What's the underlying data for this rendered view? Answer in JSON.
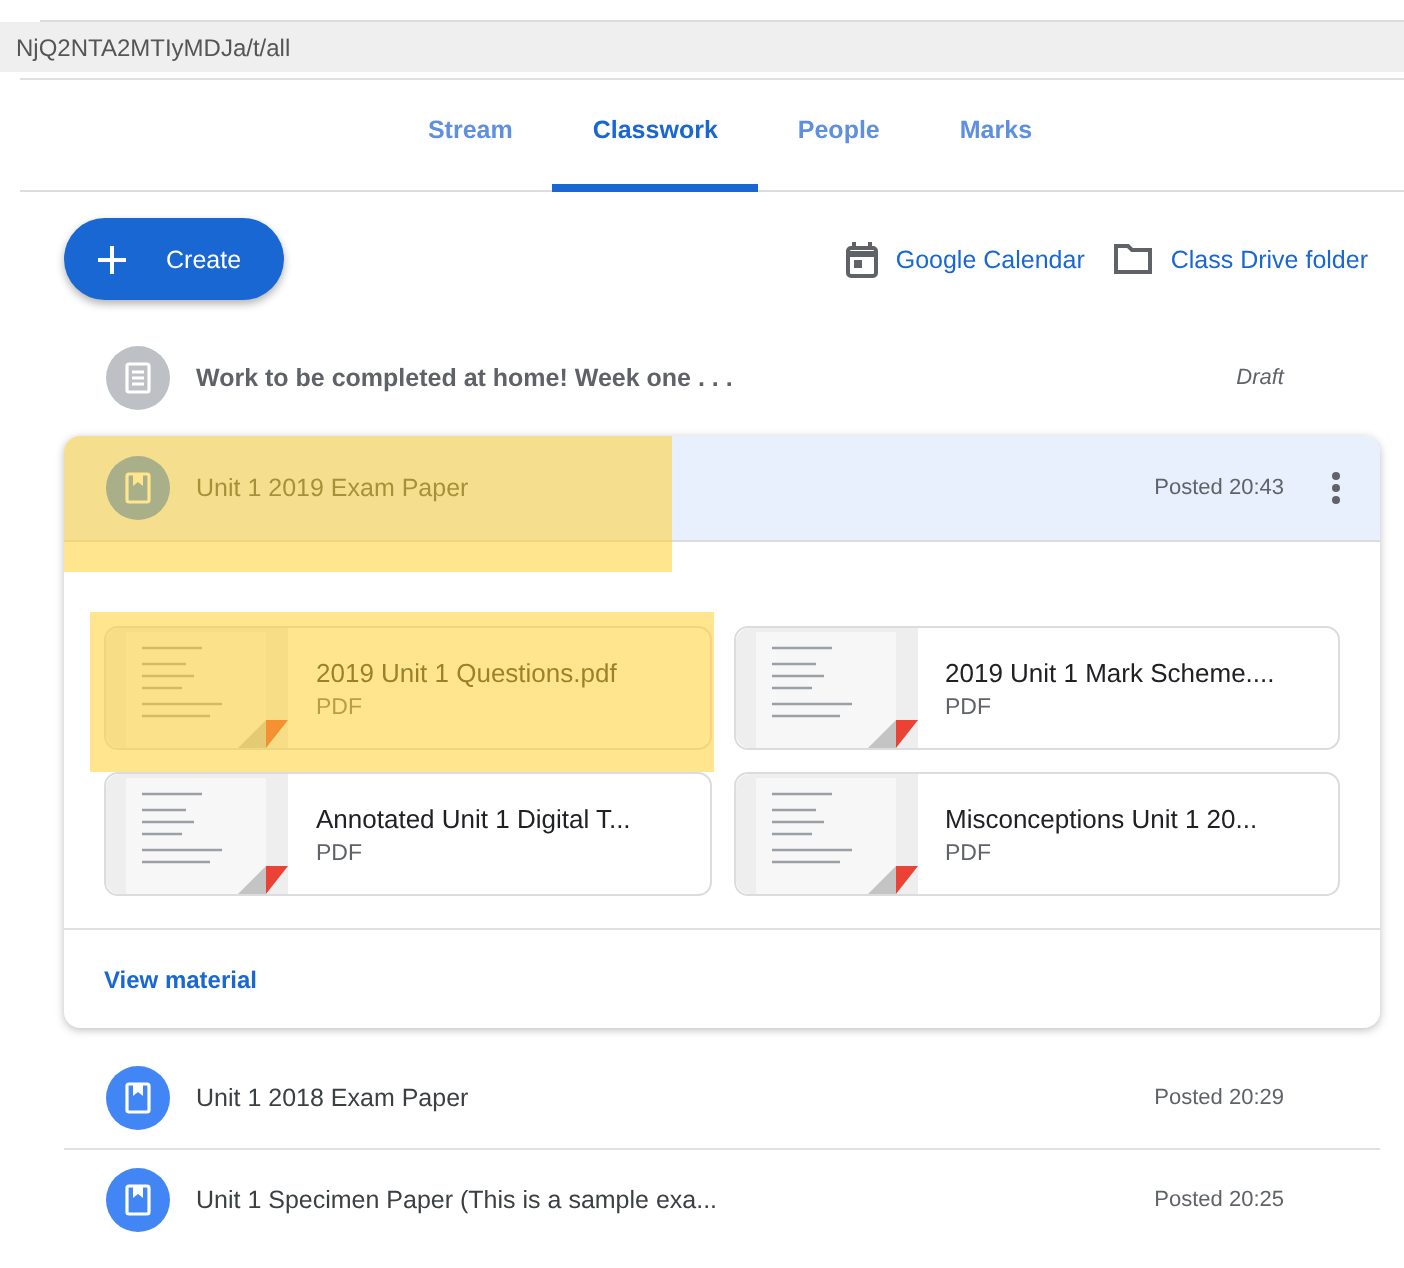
{
  "address_bar": {
    "url": "NjQ2NTA2MTIyMDJa/t/all"
  },
  "tabs": [
    {
      "label": "Stream",
      "selected": false
    },
    {
      "label": "Classwork",
      "selected": true
    },
    {
      "label": "People",
      "selected": false
    },
    {
      "label": "Marks",
      "selected": false
    }
  ],
  "create_button": {
    "label": "Create"
  },
  "links": [
    {
      "kind": "calendar",
      "label": "Google Calendar"
    },
    {
      "kind": "folder",
      "label": "Class Drive folder"
    }
  ],
  "items": [
    {
      "kind": "assignment",
      "title": "Work to be completed at home! Week one . . .",
      "status": "Draft",
      "draft": true,
      "expanded": false,
      "highlighted": false
    },
    {
      "kind": "material",
      "title": "Unit 1 2019 Exam Paper",
      "status": "Posted 20:43",
      "draft": false,
      "expanded": true,
      "highlighted": true,
      "attachments": [
        {
          "name": "2019 Unit 1 Questions.pdf",
          "type": "PDF",
          "highlighted": true
        },
        {
          "name": "2019 Unit 1 Mark Scheme....",
          "type": "PDF",
          "highlighted": false
        },
        {
          "name": "Annotated Unit 1 Digital T...",
          "type": "PDF",
          "highlighted": false
        },
        {
          "name": "Misconceptions Unit 1 20...",
          "type": "PDF",
          "highlighted": false
        }
      ],
      "footer_link": "View material"
    },
    {
      "kind": "material",
      "title": "Unit 1 2018 Exam Paper",
      "status": "Posted 20:29",
      "draft": false,
      "expanded": false,
      "highlighted": false
    },
    {
      "kind": "material",
      "title": "Unit 1 Specimen Paper (This is a sample exa...",
      "status": "Posted 20:25",
      "draft": false,
      "expanded": false,
      "highlighted": false
    }
  ]
}
